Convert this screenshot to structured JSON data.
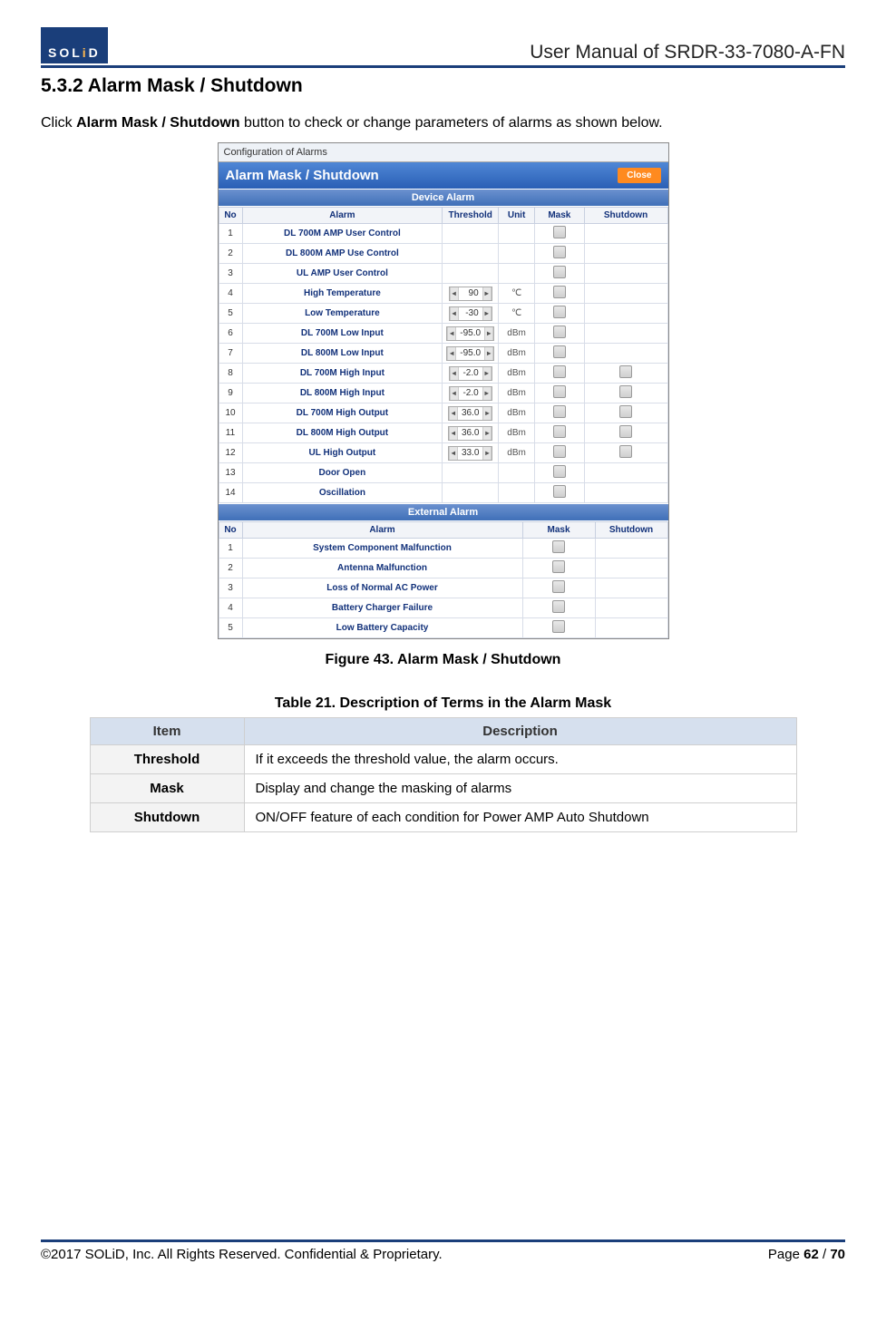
{
  "header": {
    "logo_text_prefix": "SOL",
    "logo_text_dot": "i",
    "logo_text_suffix": "D",
    "manual_title": "User Manual of SRDR-33-7080-A-FN"
  },
  "section": {
    "number": "5.3.2",
    "title": "Alarm Mask / Shutdown",
    "intro_prefix": "Click ",
    "intro_bold": "Alarm Mask / Shutdown",
    "intro_suffix": " button to check or change parameters of alarms as shown below."
  },
  "dialog": {
    "window_title": "Configuration of Alarms",
    "header_title": "Alarm Mask / Shutdown",
    "close_label": "Close",
    "device_banner": "Device Alarm",
    "external_banner": "External Alarm",
    "cols": {
      "no": "No",
      "alarm": "Alarm",
      "threshold": "Threshold",
      "unit": "Unit",
      "mask": "Mask",
      "shutdown": "Shutdown"
    },
    "device_rows": [
      {
        "no": "1",
        "alarm": "DL 700M AMP User Control",
        "thresh": "",
        "unit": "",
        "mask": true,
        "shutdown": false
      },
      {
        "no": "2",
        "alarm": "DL 800M AMP Use Control",
        "thresh": "",
        "unit": "",
        "mask": true,
        "shutdown": false
      },
      {
        "no": "3",
        "alarm": "UL AMP User Control",
        "thresh": "",
        "unit": "",
        "mask": true,
        "shutdown": false
      },
      {
        "no": "4",
        "alarm": "High Temperature",
        "thresh": "90",
        "unit": "℃",
        "mask": true,
        "shutdown": false
      },
      {
        "no": "5",
        "alarm": "Low Temperature",
        "thresh": "-30",
        "unit": "℃",
        "mask": true,
        "shutdown": false
      },
      {
        "no": "6",
        "alarm": "DL 700M Low Input",
        "thresh": "-95.0",
        "unit": "dBm",
        "mask": true,
        "shutdown": false
      },
      {
        "no": "7",
        "alarm": "DL 800M Low Input",
        "thresh": "-95.0",
        "unit": "dBm",
        "mask": true,
        "shutdown": false
      },
      {
        "no": "8",
        "alarm": "DL 700M High Input",
        "thresh": "-2.0",
        "unit": "dBm",
        "mask": true,
        "shutdown": true
      },
      {
        "no": "9",
        "alarm": "DL 800M High Input",
        "thresh": "-2.0",
        "unit": "dBm",
        "mask": true,
        "shutdown": true
      },
      {
        "no": "10",
        "alarm": "DL 700M High Output",
        "thresh": "36.0",
        "unit": "dBm",
        "mask": true,
        "shutdown": true
      },
      {
        "no": "11",
        "alarm": "DL 800M High Output",
        "thresh": "36.0",
        "unit": "dBm",
        "mask": true,
        "shutdown": true
      },
      {
        "no": "12",
        "alarm": "UL High Output",
        "thresh": "33.0",
        "unit": "dBm",
        "mask": true,
        "shutdown": true
      },
      {
        "no": "13",
        "alarm": "Door Open",
        "thresh": "",
        "unit": "",
        "mask": true,
        "shutdown": false
      },
      {
        "no": "14",
        "alarm": "Oscillation",
        "thresh": "",
        "unit": "",
        "mask": true,
        "shutdown": false
      }
    ],
    "external_rows": [
      {
        "no": "1",
        "alarm": "System Component Malfunction",
        "mask": true
      },
      {
        "no": "2",
        "alarm": "Antenna Malfunction",
        "mask": true
      },
      {
        "no": "3",
        "alarm": "Loss of Normal AC Power",
        "mask": true
      },
      {
        "no": "4",
        "alarm": "Battery Charger Failure",
        "mask": true
      },
      {
        "no": "5",
        "alarm": "Low Battery Capacity",
        "mask": true
      }
    ]
  },
  "figure_caption": "Figure 43. Alarm Mask / Shutdown",
  "table_caption": "Table 21. Description of Terms in the Alarm Mask",
  "desc_table": {
    "headers": {
      "item": "Item",
      "description": "Description"
    },
    "rows": [
      {
        "item": "Threshold",
        "desc": "If it exceeds the threshold value, the alarm occurs."
      },
      {
        "item": "Mask",
        "desc": "Display and change the masking of alarms"
      },
      {
        "item": "Shutdown",
        "desc": "ON/OFF feature of each condition for Power AMP Auto Shutdown"
      }
    ]
  },
  "footer": {
    "copyright": "©2017 SOLiD, Inc. All Rights Reserved. Confidential & Proprietary.",
    "page_label_prefix": "Page ",
    "page_current": "62",
    "page_sep": " / ",
    "page_total": "70"
  }
}
